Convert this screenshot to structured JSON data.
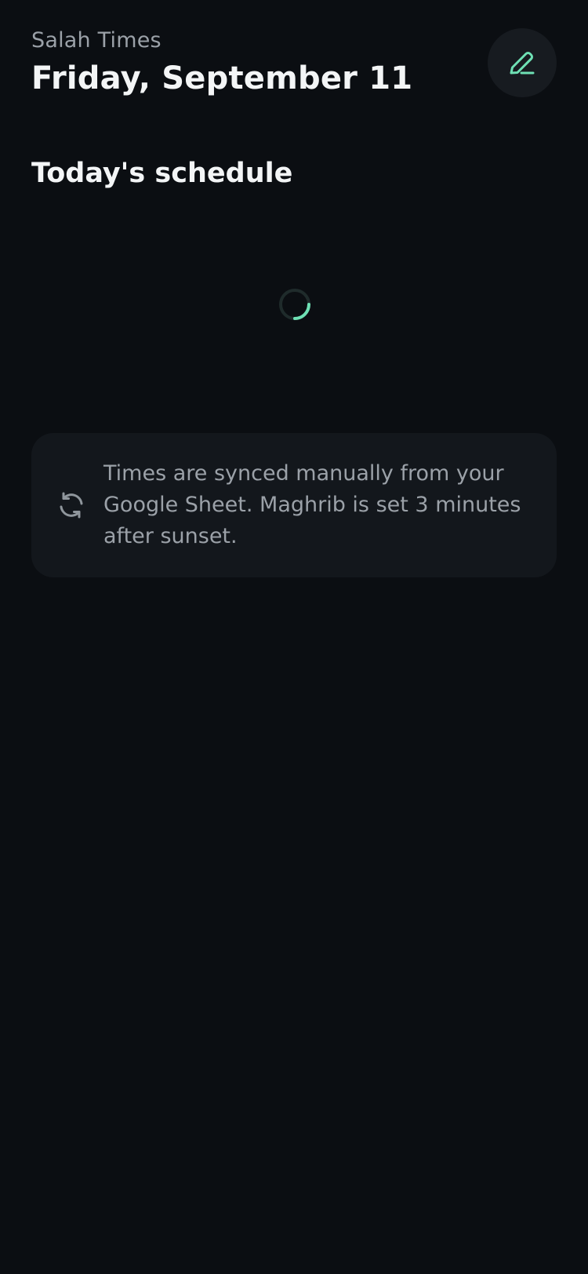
{
  "header": {
    "app_label": "Salah Times",
    "date_title": "Friday, September 11",
    "edit_icon": "pencil-icon"
  },
  "schedule": {
    "title": "Today's schedule",
    "loading_icon": "loading-spinner"
  },
  "info_card": {
    "icon": "sync-icon",
    "text": "Times are synced manually from your Google Sheet. Maghrib is set 3 minutes after sunset."
  },
  "colors": {
    "background": "#0b0e12",
    "card": "#13171c",
    "accent": "#6ee0b4",
    "muted_text": "#9ba1a8",
    "primary_text": "#f3f5f6"
  }
}
